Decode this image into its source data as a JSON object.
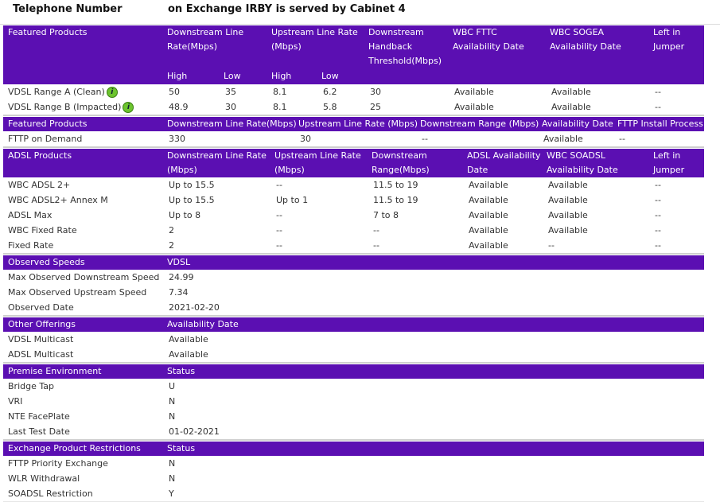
{
  "header": {
    "telephone_label": "Telephone Number",
    "exchange_text": "on Exchange IRBY is served by Cabinet 4"
  },
  "fttc": {
    "cols": [
      "Featured Products",
      "Downstream Line Rate(Mbps)",
      "Upstream Line Rate (Mbps)",
      "Downstream Handback Threshold(Mbps)",
      "WBC FTTC Availability Date",
      "WBC SOGEA Availability Date",
      "Left in Jumper"
    ],
    "sub": [
      "High",
      "Low",
      "High",
      "Low"
    ],
    "rows": [
      [
        "VDSL Range A (Clean)",
        "50",
        "35",
        "8.1",
        "6.2",
        "30",
        "Available",
        "Available",
        "--"
      ],
      [
        "VDSL Range B (Impacted)",
        "48.9",
        "30",
        "8.1",
        "5.8",
        "25",
        "Available",
        "Available",
        "--"
      ]
    ]
  },
  "fttp": {
    "cols": [
      "Featured Products",
      "Downstream Line Rate(Mbps)",
      "Upstream Line Rate (Mbps)",
      "Downstream Range (Mbps)",
      "Availability Date",
      "FTTP Install Process"
    ],
    "rows": [
      [
        "FTTP on Demand",
        "330",
        "30",
        "--",
        "Available",
        "--"
      ]
    ]
  },
  "adsl": {
    "cols": [
      "ADSL Products",
      "Downstream Line Rate (Mbps)",
      "Upstream Line Rate (Mbps)",
      "Downstream Range(Mbps)",
      "ADSL Availability Date",
      "WBC SOADSL Availability Date",
      "Left in Jumper"
    ],
    "rows": [
      [
        "WBC ADSL 2+",
        "Up to 15.5",
        "--",
        "11.5 to 19",
        "Available",
        "Available",
        "--"
      ],
      [
        "WBC ADSL2+ Annex M",
        "Up to 15.5",
        "Up to 1",
        "11.5 to 19",
        "Available",
        "Available",
        "--"
      ],
      [
        "ADSL Max",
        "Up to 8",
        "--",
        "7 to 8",
        "Available",
        "Available",
        "--"
      ],
      [
        "WBC Fixed Rate",
        "2",
        "--",
        "--",
        "Available",
        "Available",
        "--"
      ],
      [
        "Fixed Rate",
        "2",
        "--",
        "--",
        "Available",
        "--",
        "--"
      ]
    ]
  },
  "observed": {
    "cols": [
      "Observed Speeds",
      "VDSL"
    ],
    "rows": [
      [
        "Max Observed Downstream Speed",
        "24.99"
      ],
      [
        "Max Observed Upstream Speed",
        "7.34"
      ],
      [
        "Observed Date",
        "2021-02-20"
      ]
    ]
  },
  "other": {
    "cols": [
      "Other Offerings",
      "Availability Date"
    ],
    "rows": [
      [
        "VDSL Multicast",
        "Available"
      ],
      [
        "ADSL Multicast",
        "Available"
      ]
    ]
  },
  "premise": {
    "cols": [
      "Premise Environment",
      "Status"
    ],
    "rows": [
      [
        "Bridge Tap",
        "U"
      ],
      [
        "VRI",
        "N"
      ],
      [
        "NTE FacePlate",
        "N"
      ],
      [
        "Last Test Date",
        "01-02-2021"
      ]
    ]
  },
  "restrictions": {
    "cols": [
      "Exchange Product Restrictions",
      "Status"
    ],
    "rows": [
      [
        "FTTP Priority Exchange",
        "N"
      ],
      [
        "WLR Withdrawal",
        "N"
      ],
      [
        "SOADSL Restriction",
        "Y"
      ]
    ]
  },
  "colors": {
    "header_bg": "#5b0fb2",
    "info_icon": "#6cc42e"
  }
}
